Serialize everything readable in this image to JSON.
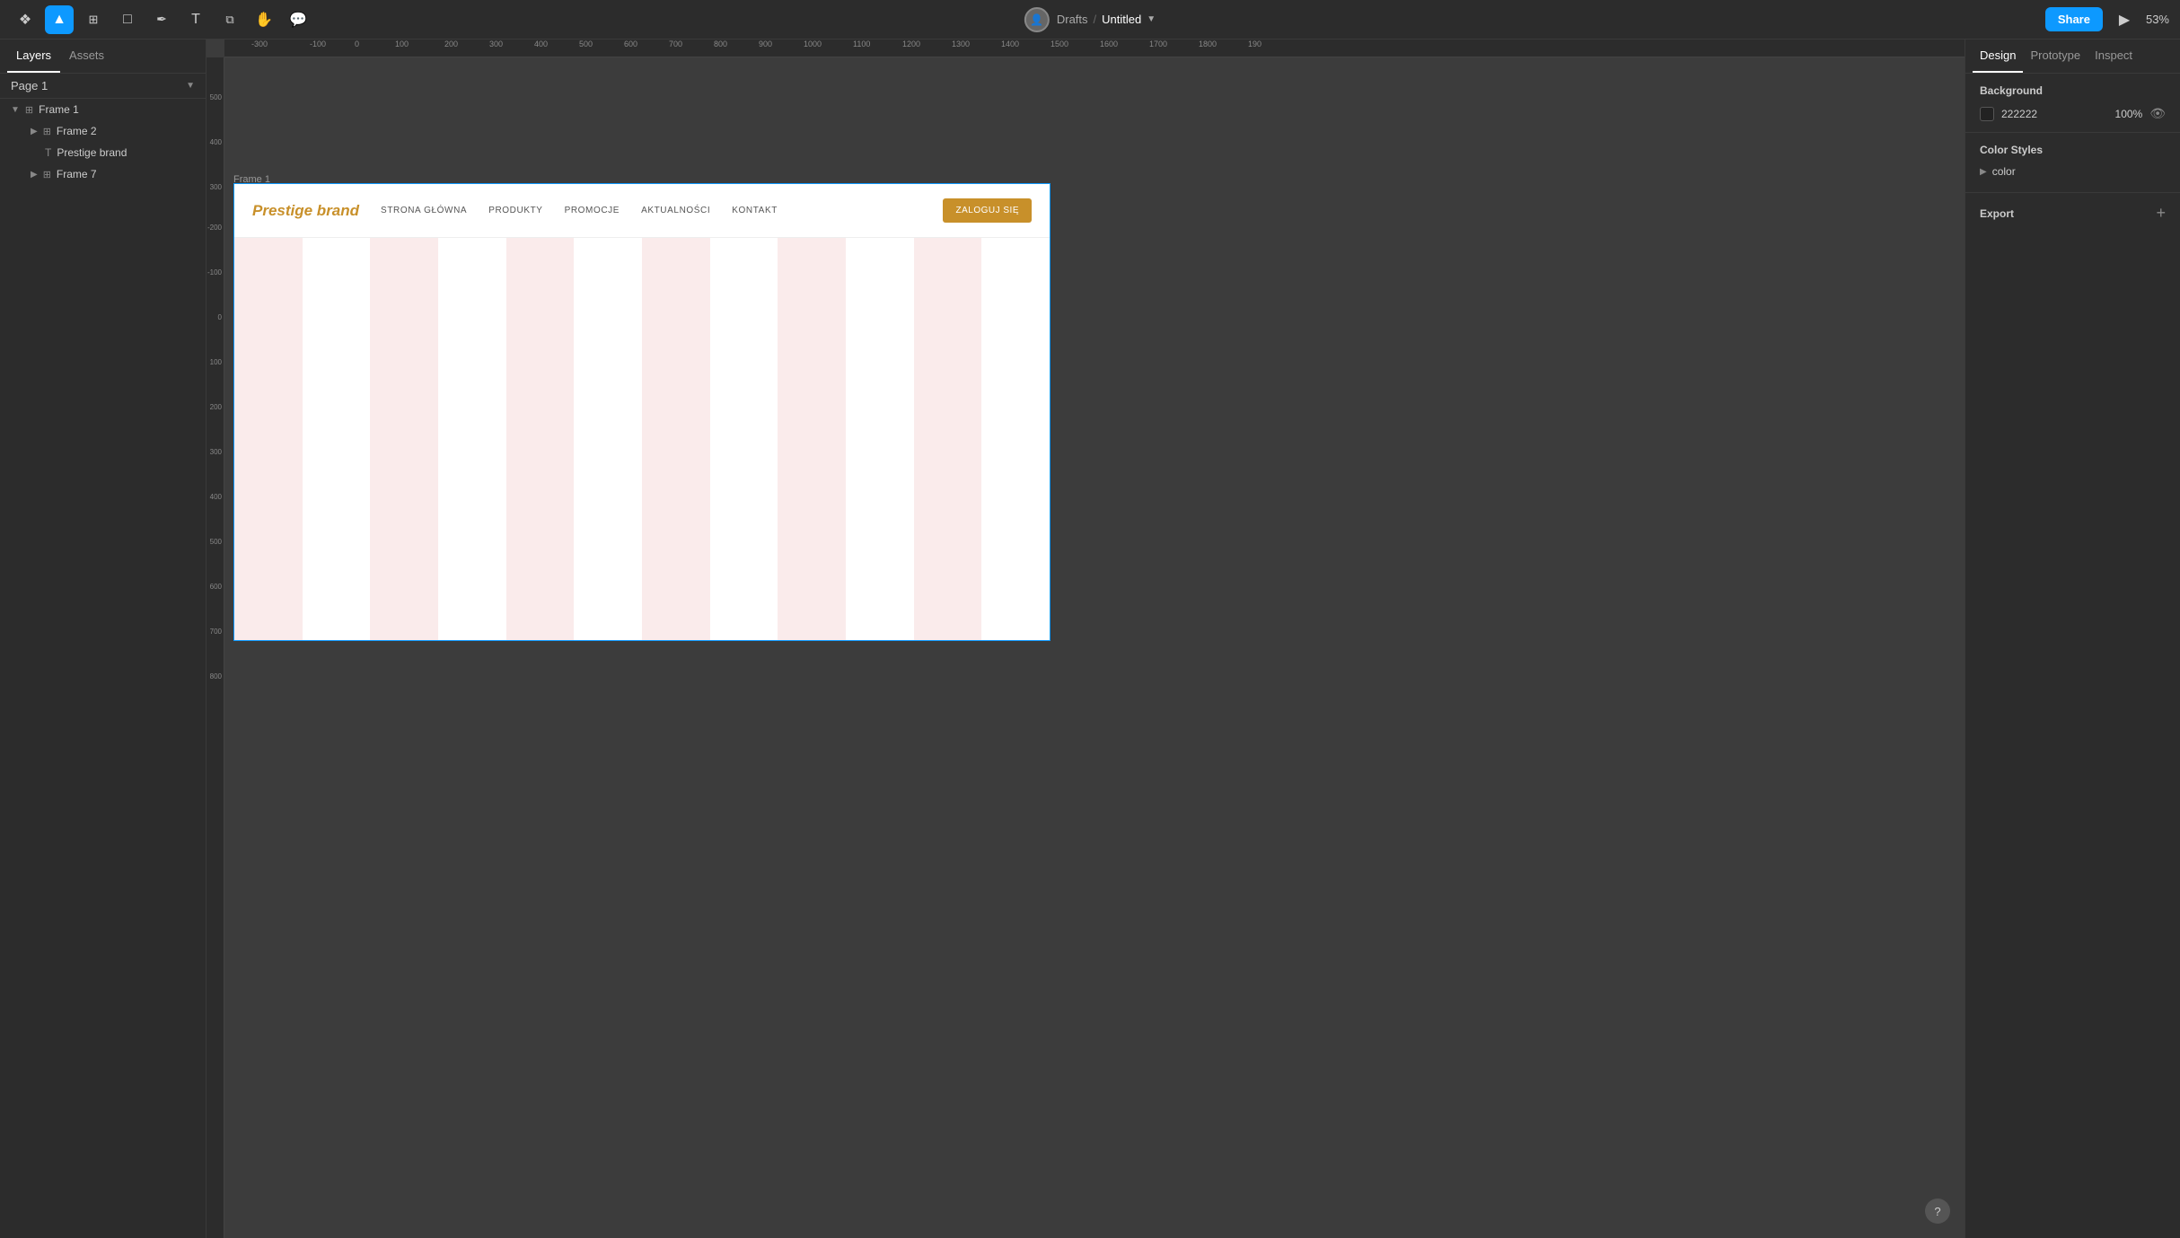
{
  "toolbar": {
    "title": "Untitled",
    "location": "Drafts",
    "separator": "/",
    "share_label": "Share",
    "zoom_label": "53%",
    "tools": [
      {
        "name": "figma-menu",
        "icon": "❖",
        "active": false
      },
      {
        "name": "select-tool",
        "icon": "▲",
        "active": true
      },
      {
        "name": "frame-tool",
        "icon": "⊞",
        "active": false
      },
      {
        "name": "shape-tool",
        "icon": "□",
        "active": false
      },
      {
        "name": "pen-tool",
        "icon": "✒",
        "active": false
      },
      {
        "name": "text-tool",
        "icon": "T",
        "active": false
      },
      {
        "name": "component-tool",
        "icon": "⧉",
        "active": false
      },
      {
        "name": "hand-tool",
        "icon": "✋",
        "active": false
      },
      {
        "name": "comment-tool",
        "icon": "💬",
        "active": false
      }
    ]
  },
  "left_panel": {
    "tabs": [
      "Layers",
      "Assets"
    ],
    "active_tab": "Layers",
    "page": "Page 1",
    "layers": [
      {
        "id": "frame1",
        "label": "Frame 1",
        "icon": "frame",
        "indent": 0,
        "expanded": true
      },
      {
        "id": "frame2",
        "label": "Frame 2",
        "icon": "frame",
        "indent": 1,
        "expanded": false
      },
      {
        "id": "prestige-brand",
        "label": "Prestige brand",
        "icon": "text",
        "indent": 2,
        "expanded": false
      },
      {
        "id": "frame7",
        "label": "Frame 7",
        "icon": "frame",
        "indent": 1,
        "expanded": false
      }
    ]
  },
  "canvas": {
    "frame_label": "Frame 1",
    "background": "#3c3c3c"
  },
  "right_panel": {
    "tabs": [
      "Design",
      "Prototype",
      "Inspect"
    ],
    "active_tab": "Design",
    "background_section": {
      "title": "Background",
      "color_hex": "222222",
      "opacity": "100%"
    },
    "color_styles_section": {
      "title": "Color Styles",
      "items": [
        {
          "label": "color"
        }
      ]
    },
    "export_section": {
      "title": "Export"
    }
  },
  "design_frame": {
    "brand": "Prestige brand",
    "nav_items": [
      "STRONA GŁÓWNA",
      "PRODUKTY",
      "PROMOCJE",
      "AKTUALNOŚCI",
      "KONTAKT"
    ],
    "cta_label": "ZALOGUJ SIĘ"
  }
}
